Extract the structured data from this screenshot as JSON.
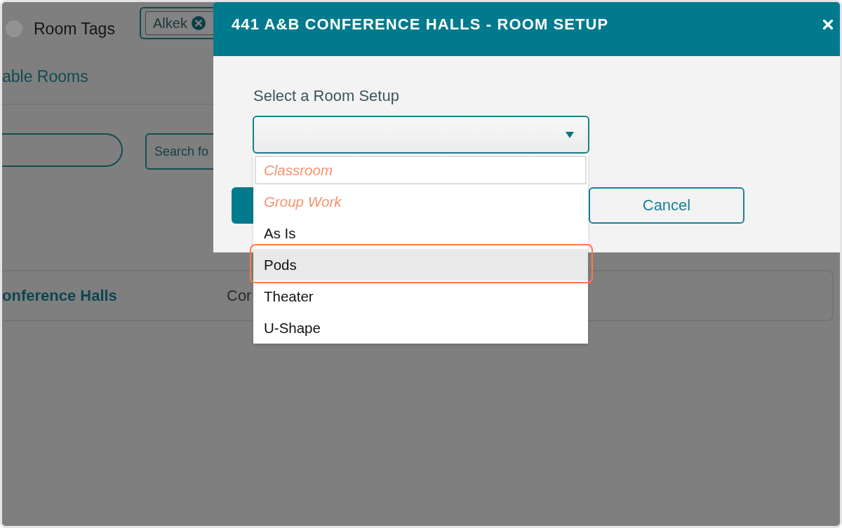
{
  "page": {
    "filter": {
      "radio": {
        "selected": false
      },
      "label": "Room Tags",
      "tags": [
        {
          "label": "Alkek"
        }
      ]
    },
    "link": "able Rooms",
    "search_field": {
      "placeholder": "Search fo"
    },
    "result": {
      "name": "onference Halls",
      "column_2": "Cor"
    }
  },
  "modal": {
    "title": "441 A&B CONFERENCE HALLS - ROOM SETUP",
    "field_label": "Select a Room Setup",
    "select": {
      "expanded": true
    },
    "options": [
      {
        "label": "Classroom",
        "unavailable": true,
        "focused": true,
        "selected": false,
        "outlined": false
      },
      {
        "label": "Group Work",
        "unavailable": true,
        "focused": false,
        "selected": false,
        "outlined": false
      },
      {
        "label": "As Is",
        "unavailable": false,
        "focused": false,
        "selected": false,
        "outlined": false
      },
      {
        "label": "Pods",
        "unavailable": false,
        "focused": false,
        "selected": true,
        "outlined": true
      },
      {
        "label": "Theater",
        "unavailable": false,
        "focused": false,
        "selected": false,
        "outlined": false
      },
      {
        "label": "U-Shape",
        "unavailable": false,
        "focused": false,
        "selected": false,
        "outlined": false
      }
    ],
    "buttons": [
      {
        "kind": "primary"
      },
      {
        "kind": "secondary",
        "label": "Cancel"
      }
    ]
  }
}
